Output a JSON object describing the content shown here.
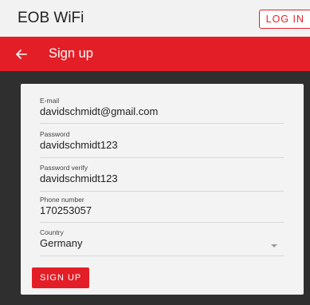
{
  "app": {
    "title": "EOB WiFi",
    "login_label": "LOG IN"
  },
  "header": {
    "title": "Sign up"
  },
  "form": {
    "fields": [
      {
        "label": "E-mail",
        "value": "davidschmidt@gmail.com"
      },
      {
        "label": "Password",
        "value": "davidschmidt123"
      },
      {
        "label": "Password verify",
        "value": "davidschmidt123"
      },
      {
        "label": "Phone number",
        "value": "170253057"
      },
      {
        "label": "Country",
        "value": "Germany"
      }
    ],
    "submit_label": "SIGN UP"
  },
  "colors": {
    "accent": "#e31e26",
    "dark_bg": "#2f2f2f",
    "card_bg": "#f3f3f3"
  },
  "icons": {
    "back": "arrow-left-icon",
    "select": "chevron-down-icon"
  }
}
